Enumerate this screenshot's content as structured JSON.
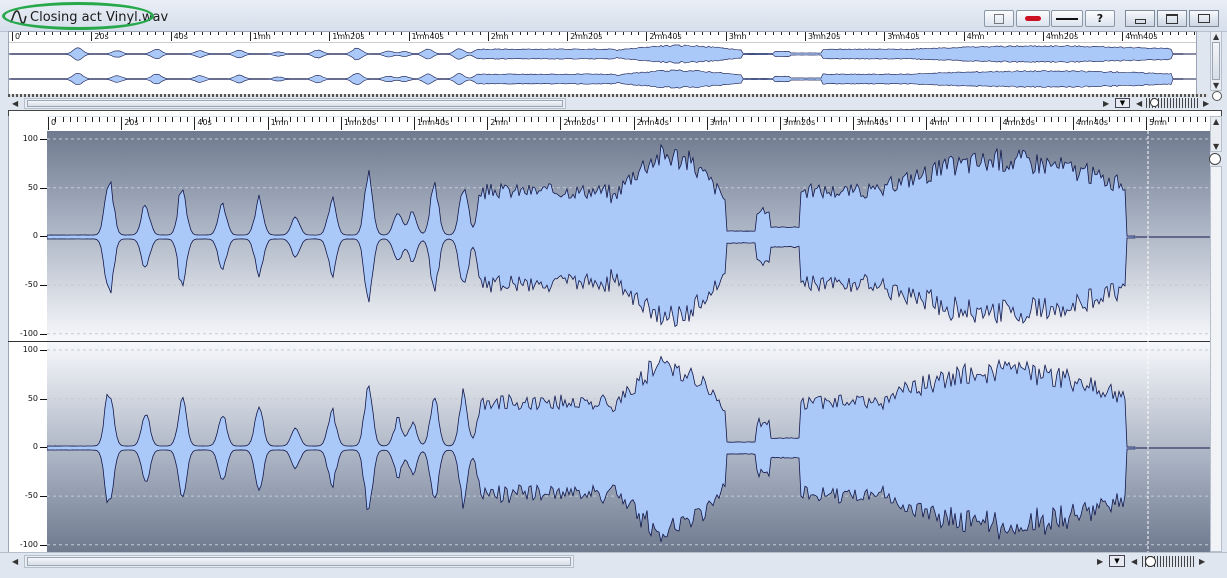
{
  "window": {
    "title": "Closing act Vinyl.wav",
    "buttons": {
      "play_label": "",
      "record_label": "",
      "line_label": "",
      "help_label": "?"
    },
    "icons": [
      "wave-app-icon",
      "minimize-icon",
      "maximize-icon",
      "close-icon"
    ]
  },
  "overview": {
    "ruler_labels": [
      "0",
      "20s",
      "40s",
      "1mn",
      "1mn20s",
      "1mn40s",
      "2mn",
      "2mn20s",
      "2mn40s",
      "3mn",
      "3mn20s",
      "3mn40s",
      "4mn",
      "4mn20s",
      "4mn40s",
      "5mn"
    ]
  },
  "main": {
    "ruler_labels": [
      "0",
      "20s",
      "40s",
      "1mn",
      "1mn20s",
      "1mn40s",
      "2mn",
      "2mn20s",
      "2mn40s",
      "3mn",
      "3mn20s",
      "3mn40s",
      "4mn",
      "4mn20s",
      "4mn40s",
      "5mn"
    ],
    "y_labels": [
      "100",
      "50",
      "0",
      "-50",
      "-100"
    ],
    "channel_count": 2,
    "waveform_color": "#aac8f8",
    "waveform_outline": "#12174a"
  },
  "colors": {
    "highlight": "#27a84a",
    "record": "#cc1122"
  }
}
